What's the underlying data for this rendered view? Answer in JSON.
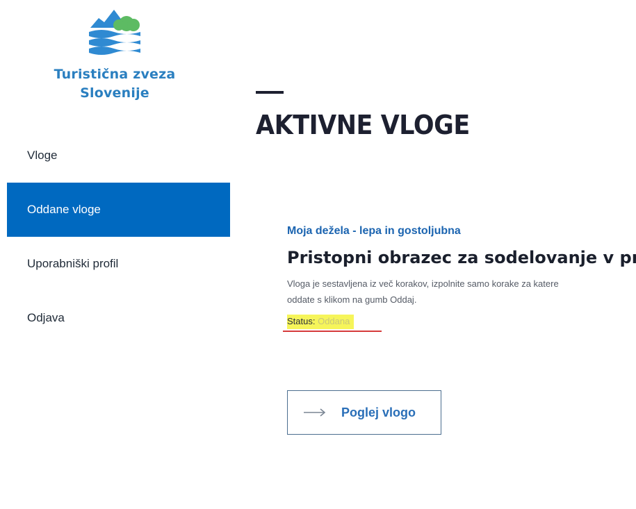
{
  "logo": {
    "line1": "Turistična zveza",
    "line2": "Slovenije",
    "colors": {
      "blue": "#2a7fc0",
      "green": "#5dbb63",
      "mountain": "#2f8ad2"
    }
  },
  "sidebar": {
    "items": [
      {
        "label": "Vloge",
        "active": false
      },
      {
        "label": "Oddane vloge",
        "active": true
      },
      {
        "label": "Uporabniški profil",
        "active": false
      },
      {
        "label": "Odjava",
        "active": false
      }
    ],
    "active_color": "#0069c0"
  },
  "main": {
    "page_title": "AKTIVNE VLOGE",
    "card": {
      "subtitle": "Moja dežela - lepa in gostoljubna",
      "title": "Pristopni obrazec za sodelovanje v pr",
      "description_line1": "Vloga je sestavljena iz več korakov, izpolnite samo korake za katere",
      "description_line2": "oddate s klikom na gumb Oddaj.",
      "status_label": "Status:",
      "status_value": "Oddana",
      "button_label": "Poglej vlogo",
      "button_icon": "arrow-right-icon"
    }
  },
  "colors": {
    "highlight": "#f6f55a",
    "underline": "#d53a3a",
    "link": "#1b64b0"
  }
}
